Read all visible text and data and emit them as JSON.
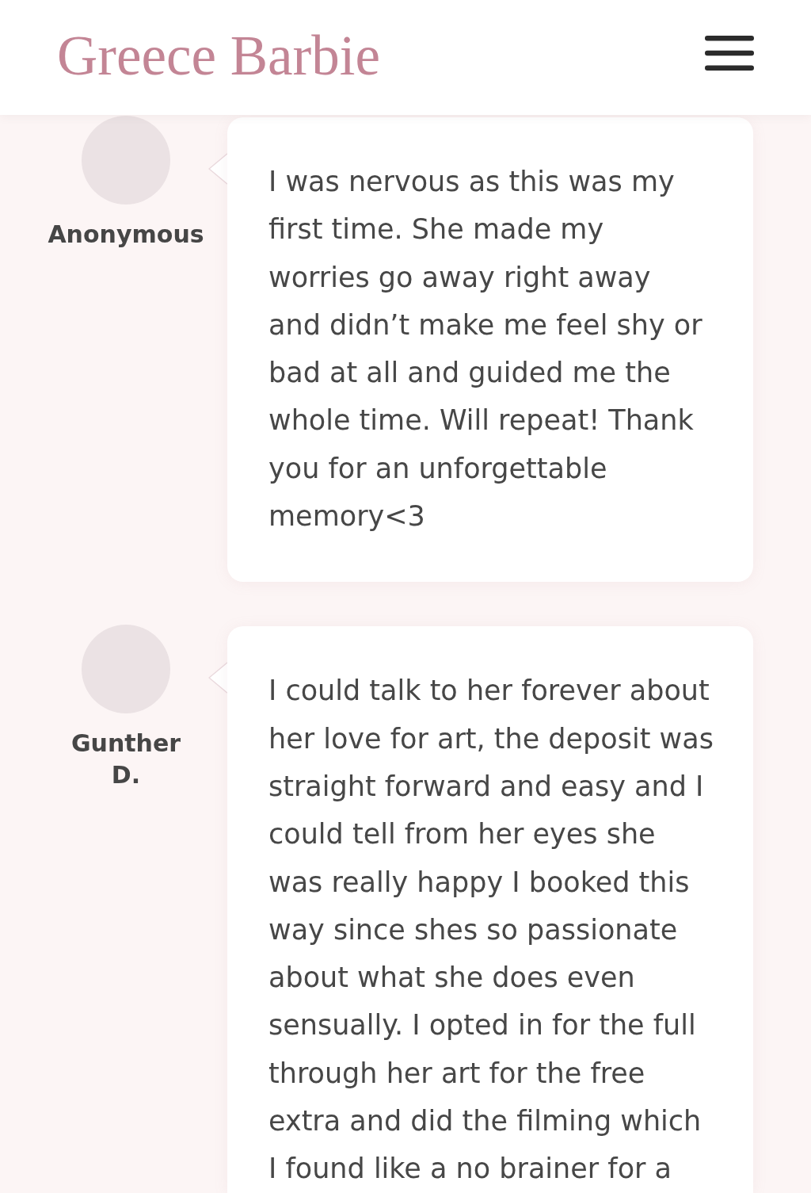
{
  "header": {
    "logo": "Greece Barbie"
  },
  "reviews": [
    {
      "author": "Anonymous",
      "text_lines": [
        "I was nervous as this was my",
        "first time. She made my",
        "worries go away right away",
        "and didn’t make me feel shy or",
        "bad at all and guided me the",
        "whole time. Will repeat! Thank",
        "you for an unforgettable",
        "memory<3"
      ]
    },
    {
      "author": "Gunther D.",
      "text_lines": [
        "I could talk to her forever about",
        "her love for art, the deposit was",
        "straight forward and easy and I",
        "could tell from her eyes she",
        "was really happy I booked this",
        "way since shes so passionate",
        "about what she does even",
        "sensually. I opted in for the full",
        "through her art for the free",
        "extra and did the filming which",
        "I found like a no brainer for a"
      ]
    }
  ]
}
